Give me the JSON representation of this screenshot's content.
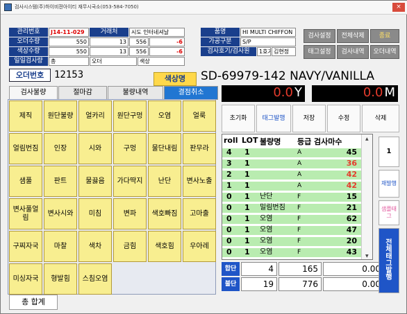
{
  "window": {
    "title": "검사시스템(주)하이비젼아이티 재무시국소(053-584-7050)",
    "close": "×"
  },
  "header": {
    "row1": {
      "label_a": "관리번호",
      "val_a": "J14-11-029",
      "label_b": "거래처",
      "val_b": "시도 인터네셔날",
      "label_c": "품명",
      "val_c": "HI MULTI CHIFFON"
    },
    "row2": {
      "label_a": "오더수량",
      "n1": "550",
      "n2": "13",
      "n3": "556",
      "n4": "-6",
      "label_c": "가공구분",
      "val_c": "S/P"
    },
    "row3": {
      "label_a": "색상수량",
      "n1": "550",
      "n2": "13",
      "n3": "556",
      "n4": "-6",
      "label_c": "검사호기/검사원",
      "val_c1": "1호기",
      "val_c2": "김현정"
    },
    "row4": {
      "label_a": "일일검사량",
      "t1": "총",
      "t2": "오더",
      "t3": "색상"
    }
  },
  "top_buttons": [
    "검사설정",
    "전체삭제",
    "종료",
    "태그설정",
    "검사내역",
    "오더내역"
  ],
  "order": {
    "label": "오더번호",
    "value": "12153",
    "color_label": "색상명",
    "color_value": "SD-69979-142  NAVY/VANILLA"
  },
  "tabs": [
    "검사불량",
    "절마감",
    "불량내역",
    "결점취소"
  ],
  "readouts": {
    "yard_value": "0.0",
    "yard_unit": "Y",
    "meter_value": "0.0",
    "meter_unit": "M"
  },
  "defects": [
    [
      "제직",
      "원단불량",
      "얼카리",
      "원단구멍",
      "오염",
      "얼룩"
    ],
    [
      "얼림번짐",
      "인장",
      "시와",
      "구멍",
      "물단내림",
      "판무라"
    ],
    [
      "샘풀",
      "판트",
      "물끓음",
      "가다딱지",
      "난단",
      "변사노출"
    ],
    [
      "변사풀얼림",
      "변사시와",
      "미침",
      "변파",
      "색호빠짐",
      "고마출"
    ],
    [
      "구찌자국",
      "마찰",
      "색차",
      "금힘",
      "색호힘",
      "우아레"
    ],
    [
      "미싱자국",
      "형발힘",
      "스침오염"
    ]
  ],
  "total_label": "총 합계",
  "actions": [
    "초기화",
    "태그발행",
    "저장",
    "수정",
    "삭제"
  ],
  "table": {
    "headers": [
      "roll",
      "LOT",
      "불량명",
      "등급",
      "검사마수"
    ],
    "rows": [
      [
        "4",
        "1",
        "",
        "A",
        "45",
        "normal"
      ],
      [
        "3",
        "1",
        "",
        "A",
        "36",
        "red"
      ],
      [
        "2",
        "1",
        "",
        "A",
        "42",
        "red"
      ],
      [
        "1",
        "1",
        "",
        "A",
        "42",
        "red"
      ],
      [
        "0",
        "1",
        "난단",
        "F",
        "15",
        "normal"
      ],
      [
        "0",
        "1",
        "밀림번짐",
        "F",
        "21",
        "normal"
      ],
      [
        "0",
        "1",
        "오염",
        "F",
        "62",
        "normal"
      ],
      [
        "0",
        "1",
        "오염",
        "F",
        "47",
        "normal"
      ],
      [
        "0",
        "1",
        "오염",
        "F",
        "20",
        "normal"
      ],
      [
        "0",
        "1",
        "오염",
        "F",
        "43",
        "normal"
      ]
    ]
  },
  "sums": {
    "pass_label": "합단",
    "pass_a": "4",
    "pass_b": "165",
    "pass_c": "0.00",
    "fail_label": "불단",
    "fail_a": "19",
    "fail_b": "776",
    "fail_c": "0.00"
  },
  "right_buttons": [
    "1",
    "재발행",
    "샘플태그",
    "전체태그발행"
  ],
  "colors": {
    "navy": "#1a3f8c",
    "yellow": "#f8ee90",
    "blue": "#1f55c7",
    "red": "#e53b2c",
    "green": "#b9ecb0"
  }
}
